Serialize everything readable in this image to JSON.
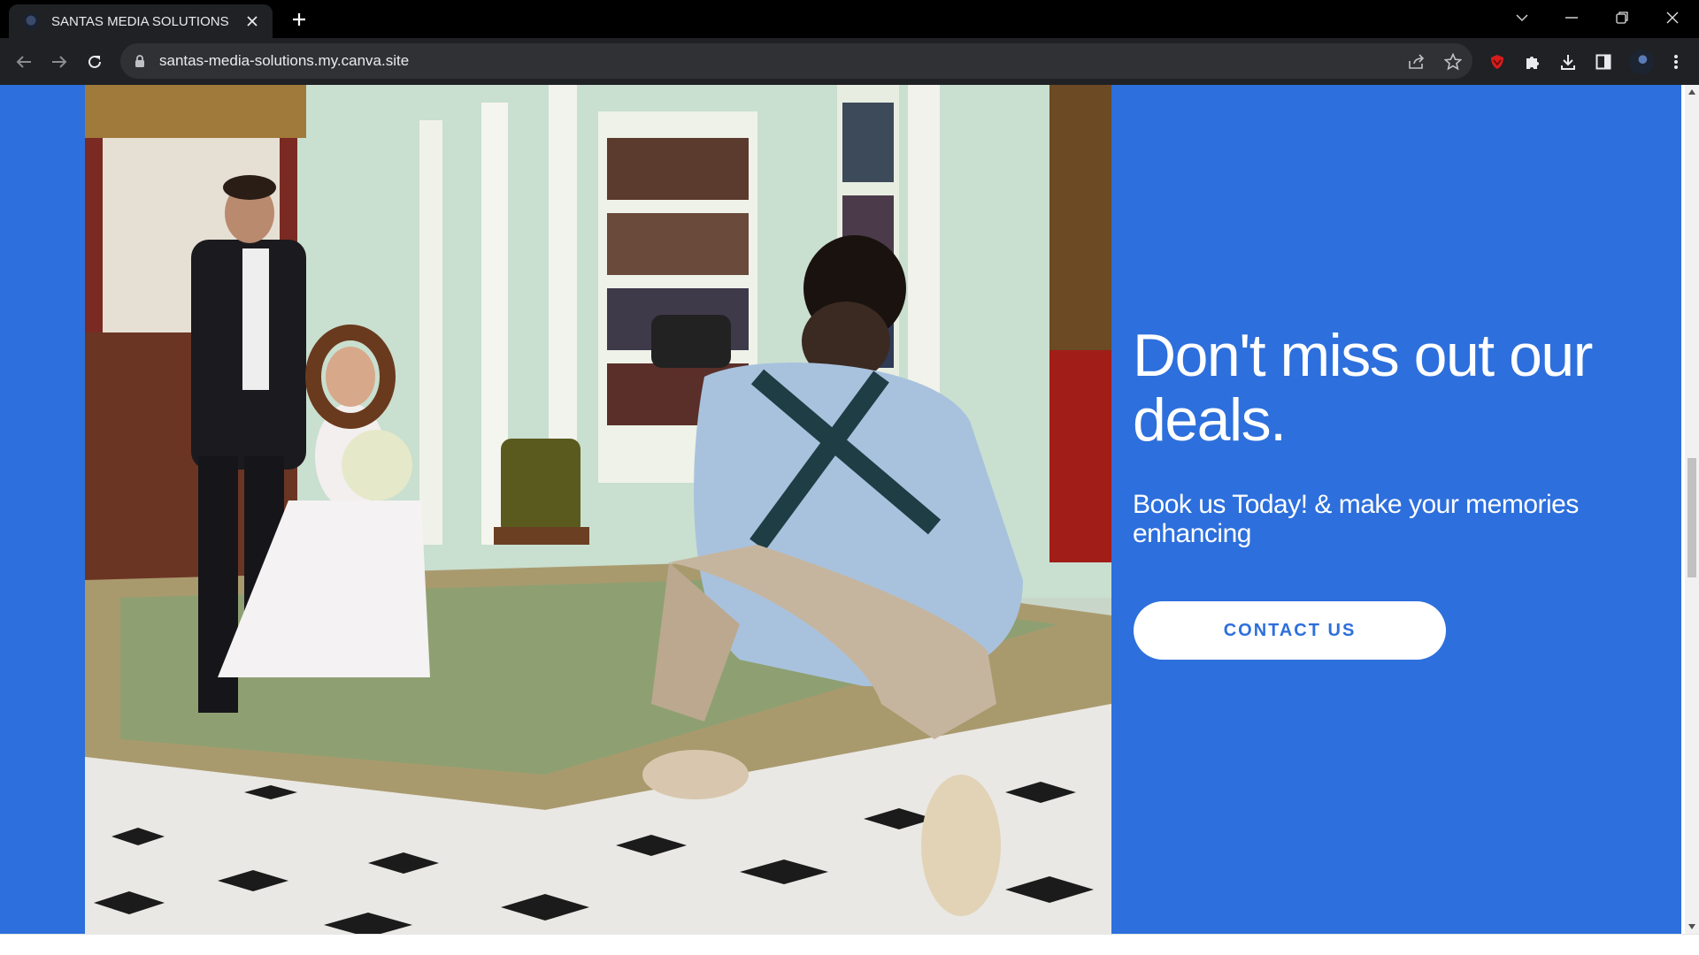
{
  "browser": {
    "tab": {
      "title": "SANTAS MEDIA SOLUTIONS",
      "favicon_icon": "site-favicon-icon",
      "close_icon": "close-icon"
    },
    "new_tab_icon": "plus-icon",
    "window_controls": [
      "tab-search-icon",
      "minimize-icon",
      "restore-icon",
      "close-window-icon"
    ],
    "nav": {
      "back_icon": "arrow-left-icon",
      "forward_icon": "arrow-right-icon",
      "reload_icon": "reload-icon"
    },
    "address_bar": {
      "url": "santas-media-solutions.my.canva.site",
      "lock_icon": "lock-icon"
    },
    "toolbar_icons": [
      "share-icon",
      "star-icon",
      "extension-shield-icon",
      "puzzle-icon",
      "download-icon",
      "side-panel-icon",
      "profile-avatar",
      "kebab-menu-icon"
    ]
  },
  "page": {
    "hero_photo_alt": "photo",
    "headline": "Don't miss out our deals.",
    "subhead": "Book us Today! & make your memories enhancing",
    "cta_label": "CONTACT US",
    "colors": {
      "section_background": "#2d6fdc",
      "cta_background": "#ffffff",
      "cta_text": "#2d6fdc",
      "text": "#ffffff"
    }
  }
}
